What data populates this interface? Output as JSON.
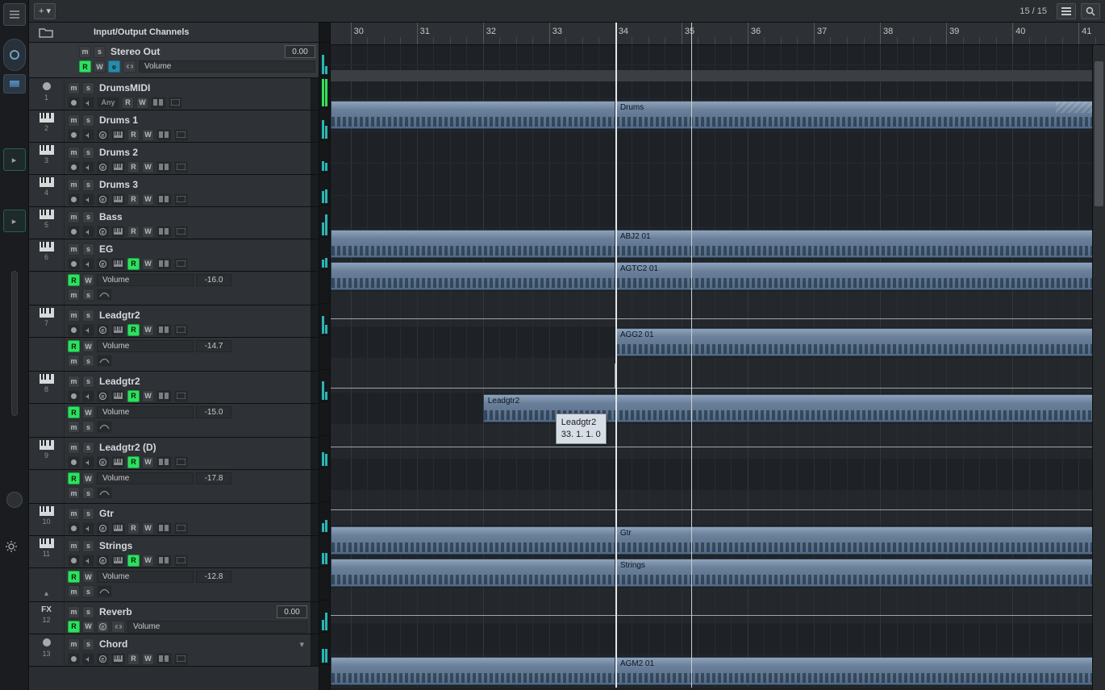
{
  "toolbar": {
    "track_count": "15 / 15",
    "add_label": "+"
  },
  "folder": {
    "label": "Input/Output Channels"
  },
  "master": {
    "name": "Stereo Out",
    "value": "0.00",
    "param": "Volume"
  },
  "tracks": [
    {
      "num": 1,
      "type": "instr",
      "name": "DrumsMIDI",
      "any": "Any"
    },
    {
      "num": 2,
      "type": "midi",
      "name": "Drums 1"
    },
    {
      "num": 3,
      "type": "midi",
      "name": "Drums 2"
    },
    {
      "num": 4,
      "type": "midi",
      "name": "Drums 3"
    },
    {
      "num": 5,
      "type": "midi",
      "name": "Bass"
    },
    {
      "num": 6,
      "type": "midi",
      "name": "EG",
      "aut_param": "Volume",
      "aut_val": "-16.0",
      "r_green": true
    },
    {
      "num": 7,
      "type": "midi",
      "name": "Leadgtr2",
      "aut_param": "Volume",
      "aut_val": "-14.7",
      "r_green": true
    },
    {
      "num": 8,
      "type": "midi",
      "name": "Leadgtr2",
      "aut_param": "Volume",
      "aut_val": "-15.0",
      "r_green": true
    },
    {
      "num": 9,
      "type": "midi",
      "name": "Leadgtr2 (D)",
      "aut_param": "Volume",
      "aut_val": "-17.8",
      "r_green": true
    },
    {
      "num": 10,
      "type": "midi",
      "name": "Gtr"
    },
    {
      "num": 11,
      "type": "midi",
      "name": "Strings",
      "aut_param": "Volume",
      "aut_val": "-12.8",
      "r_green": true
    },
    {
      "num": 12,
      "type": "fx",
      "name": "Reverb",
      "value": "0.00",
      "param": "Volume"
    },
    {
      "num": 13,
      "type": "instr",
      "name": "Chord"
    }
  ],
  "ruler": {
    "start": 29.7,
    "end": 41.4,
    "labels": [
      30,
      31,
      32,
      33,
      34,
      35,
      36,
      37,
      38,
      39,
      40,
      41
    ]
  },
  "clips": {
    "drums_split": "Drums",
    "bass": "ABJ2 01",
    "eg": "AGTC2 01",
    "lead7": "AGG2 01",
    "lead8": "Leadgtr2",
    "gtr": "Gtr",
    "strings": "Strings",
    "chord": "AGM2 01"
  },
  "tooltip": {
    "l1": "Leadgtr2",
    "l2": "33. 1. 1.  0"
  },
  "locators": {
    "left_bar": 34,
    "cursor_bar": 35.15
  }
}
